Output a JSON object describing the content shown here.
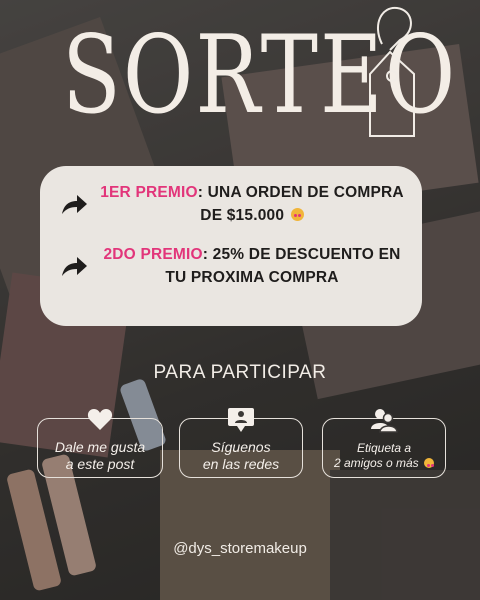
{
  "title": "SORTEO",
  "prizes": [
    {
      "highlight": "1ER PREMIO",
      "line1_rest": ": UNA ORDEN DE COMPRA",
      "line2": "DE $15.000"
    },
    {
      "highlight": "2DO PREMIO",
      "line1_rest": ": 25% DE DESCUENTO EN",
      "line2": "TU PROXIMA COMPRA"
    }
  ],
  "participate_heading": "PARA PARTICIPAR",
  "steps": [
    {
      "icon": "heart-icon",
      "line1": "Dale me gusta",
      "line2": "a este post"
    },
    {
      "icon": "profile-card-icon",
      "line1": "Síguenos",
      "line2": "en las redes"
    },
    {
      "icon": "users-icon",
      "line1": "Etiqueta a",
      "line2": "2 amigos o más"
    }
  ],
  "handle": "@dys_storemakeup",
  "colors": {
    "accent": "#e2357a",
    "card": "#eae6e1",
    "text_light": "#f1ece6"
  }
}
